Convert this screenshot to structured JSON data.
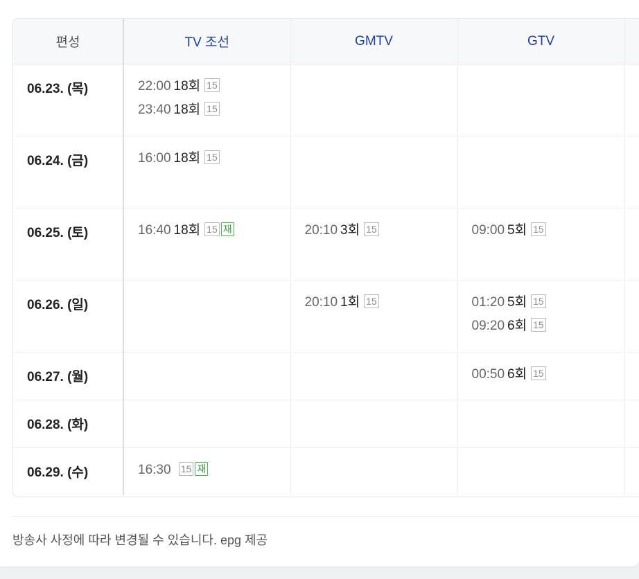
{
  "header": {
    "corner": "편성",
    "channels": [
      "TV 조선",
      "GMTV",
      "GTV",
      ""
    ]
  },
  "rows": [
    {
      "date": "06.23. (목)",
      "cells": [
        [
          {
            "time": "22:00",
            "ep": "18회",
            "badges": [
              "15"
            ]
          },
          {
            "time": "23:40",
            "ep": "18회",
            "badges": [
              "15"
            ]
          }
        ],
        [],
        [],
        []
      ]
    },
    {
      "date": "06.24. (금)",
      "cells": [
        [
          {
            "time": "16:00",
            "ep": "18회",
            "badges": [
              "15"
            ]
          }
        ],
        [],
        [],
        []
      ]
    },
    {
      "date": "06.25. (토)",
      "cells": [
        [
          {
            "time": "16:40",
            "ep": "18회",
            "badges": [
              "15",
              "재"
            ]
          }
        ],
        [
          {
            "time": "20:10",
            "ep": "3회",
            "badges": [
              "15"
            ]
          }
        ],
        [
          {
            "time": "09:00",
            "ep": "5회",
            "badges": [
              "15"
            ]
          }
        ],
        []
      ]
    },
    {
      "date": "06.26. (일)",
      "cells": [
        [],
        [
          {
            "time": "20:10",
            "ep": "1회",
            "badges": [
              "15"
            ]
          }
        ],
        [
          {
            "time": "01:20",
            "ep": "5회",
            "badges": [
              "15"
            ]
          },
          {
            "time": "09:20",
            "ep": "6회",
            "badges": [
              "15"
            ]
          }
        ],
        []
      ]
    },
    {
      "date": "06.27. (월)",
      "cells": [
        [],
        [],
        [
          {
            "time": "00:50",
            "ep": "6회",
            "badges": [
              "15"
            ]
          }
        ],
        []
      ]
    },
    {
      "date": "06.28. (화)",
      "cells": [
        [],
        [],
        [],
        []
      ]
    },
    {
      "date": "06.29. (수)",
      "cells": [
        [
          {
            "time": "16:30",
            "ep": "",
            "badges": [
              "15",
              "재"
            ]
          }
        ],
        [],
        [],
        []
      ]
    }
  ],
  "footer": "방송사 사정에 따라 변경될 수 있습니다. epg 제공",
  "colors": {
    "channel": "#1f3fa8",
    "rerun_badge": "#4caf50",
    "rating_badge": "#b5b8bd"
  }
}
